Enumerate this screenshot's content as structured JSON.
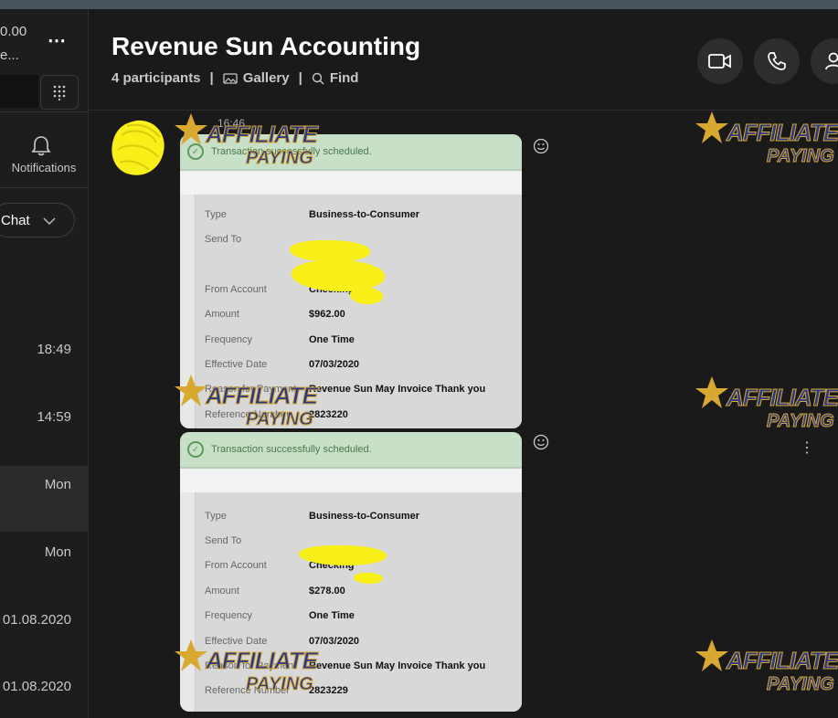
{
  "sidebar": {
    "balance_line1": "0.00",
    "balance_line2": "e...",
    "more_icon": "⋯",
    "notifications_label": "Notifications",
    "chat_filter_label": "Chat",
    "times": [
      "18:49",
      "14:59",
      "Mon",
      "Mon",
      "01.08.2020",
      "01.08.2020"
    ]
  },
  "header": {
    "title": "Revenue Sun Accounting",
    "participants": "4 participants",
    "gallery": "Gallery",
    "find": "Find"
  },
  "message": {
    "time": "16:46",
    "cards": [
      {
        "banner": "Transaction successfully scheduled.",
        "rows": [
          {
            "label": "Type",
            "value": "Business-to-Consumer"
          },
          {
            "label": "Send To",
            "value": ""
          },
          {
            "label": "",
            "value": ""
          },
          {
            "label": "From Account",
            "value": "Checking"
          },
          {
            "label": "Amount",
            "value": "$962.00"
          },
          {
            "label": "Frequency",
            "value": "One Time"
          },
          {
            "label": "Effective Date",
            "value": "07/03/2020"
          },
          {
            "label": "Reason for Payment",
            "value": "Revenue Sun May Invoice Thank you"
          },
          {
            "label": "Reference Number",
            "value": "2823220"
          }
        ]
      },
      {
        "banner": "Transaction successfully scheduled.",
        "rows": [
          {
            "label": "Type",
            "value": "Business-to-Consumer"
          },
          {
            "label": "Send To",
            "value": ""
          },
          {
            "label": "From Account",
            "value": "Checking"
          },
          {
            "label": "Amount",
            "value": "$278.00"
          },
          {
            "label": "Frequency",
            "value": "One Time"
          },
          {
            "label": "Effective Date",
            "value": "07/03/2020"
          },
          {
            "label": "Reason for Payment",
            "value": "Revenue Sun May Invoice Thank you"
          },
          {
            "label": "Reference Number",
            "value": "2823229"
          }
        ]
      }
    ]
  },
  "watermark": {
    "line1": "AFFILIATE",
    "line2": "PAYING"
  },
  "colors": {
    "background": "#1b1a1a",
    "sidebar": "#1e1d1d",
    "banner_green": "#c8dfc8",
    "highlighter": "#f8f018"
  }
}
